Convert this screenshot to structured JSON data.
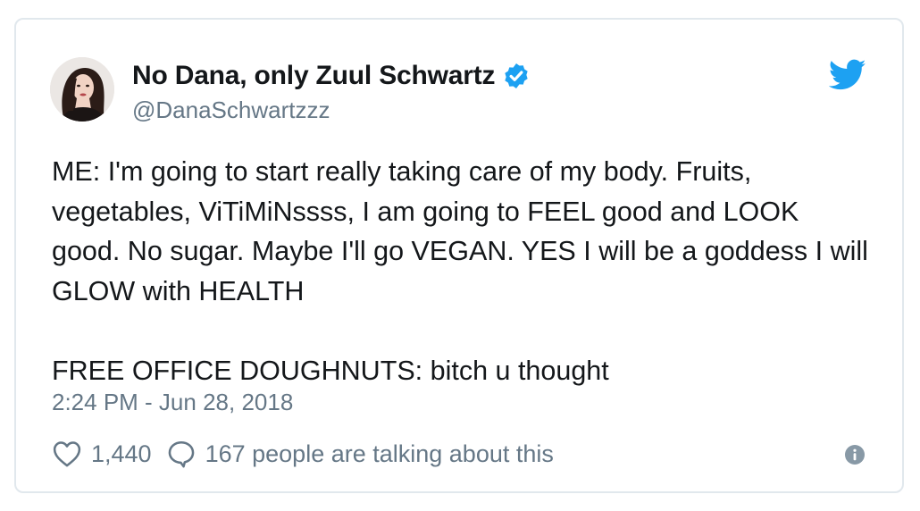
{
  "author": {
    "display_name": "No Dana, only Zuul Schwartz",
    "handle": "@DanaSchwartzzz",
    "verified": true
  },
  "tweet": {
    "text": "ME: I'm going to start really taking care of my body. Fruits, vegetables, ViTiMiNssss, I am going to FEEL good and LOOK good. No sugar. Maybe I'll go VEGAN. YES I will be a goddess I will GLOW with HEALTH\n\nFREE OFFICE DOUGHNUTS: bitch u thought",
    "timestamp": "2:24 PM - Jun 28, 2018"
  },
  "actions": {
    "like_count": "1,440",
    "reply_text": "167 people are talking about this"
  },
  "icons": {
    "brand": "twitter-bird-icon",
    "verified": "verified-badge-icon",
    "like": "heart-icon",
    "reply": "speech-bubble-icon",
    "info": "info-icon"
  },
  "colors": {
    "brand_blue": "#1da1f2",
    "text": "#14171a",
    "secondary_text": "#657786",
    "border": "#e1e8ed"
  }
}
